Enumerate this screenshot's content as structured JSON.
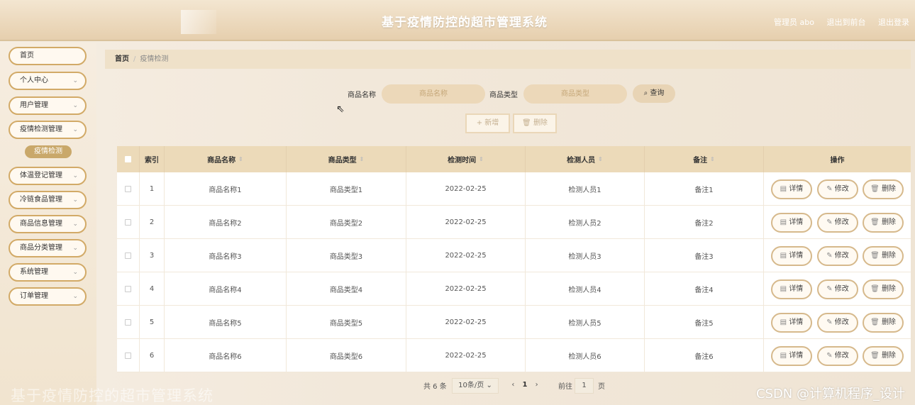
{
  "header": {
    "title": "基于疫情防控的超市管理系统",
    "user": "管理员 abo",
    "back_front": "退出到前台",
    "logout": "退出登录"
  },
  "sidebar": {
    "items": [
      {
        "label": "首页",
        "chevron": false
      },
      {
        "label": "个人中心",
        "chevron": true
      },
      {
        "label": "用户管理",
        "chevron": true
      },
      {
        "label": "疫情检测管理",
        "chevron": true
      },
      {
        "label": "体温登记管理",
        "chevron": true
      },
      {
        "label": "冷链食品管理",
        "chevron": true
      },
      {
        "label": "商品信息管理",
        "chevron": true
      },
      {
        "label": "商品分类管理",
        "chevron": true
      },
      {
        "label": "系统管理",
        "chevron": true
      },
      {
        "label": "订单管理",
        "chevron": true
      }
    ],
    "sub_active": "疫情检测",
    "chevron_glyph": "⌄"
  },
  "breadcrumb": {
    "home": "首页",
    "sep": "/",
    "current": "疫情检测"
  },
  "search": {
    "name_label": "商品名称",
    "name_placeholder": "商品名称",
    "type_label": "商品类型",
    "type_placeholder": "商品类型",
    "query_label": "查询",
    "query_icon": "search-icon"
  },
  "actions": {
    "add_label": "+ 新增",
    "delete_label": "删除"
  },
  "table": {
    "headers": [
      "索引",
      "商品名称",
      "商品类型",
      "检测时间",
      "检测人员",
      "备注",
      "操作"
    ],
    "sort_glyph": "⇕",
    "rows": [
      [
        "1",
        "商品名称1",
        "商品类型1",
        "2022-02-25",
        "检测人员1",
        "备注1"
      ],
      [
        "2",
        "商品名称2",
        "商品类型2",
        "2022-02-25",
        "检测人员2",
        "备注2"
      ],
      [
        "3",
        "商品名称3",
        "商品类型3",
        "2022-02-25",
        "检测人员3",
        "备注3"
      ],
      [
        "4",
        "商品名称4",
        "商品类型4",
        "2022-02-25",
        "检测人员4",
        "备注4"
      ],
      [
        "5",
        "商品名称5",
        "商品类型5",
        "2022-02-25",
        "检测人员5",
        "备注5"
      ],
      [
        "6",
        "商品名称6",
        "商品类型6",
        "2022-02-25",
        "检测人员6",
        "备注6"
      ]
    ],
    "ops": {
      "detail": "详情",
      "edit": "修改",
      "delete": "删除"
    }
  },
  "pagination": {
    "total": "共 6 条",
    "page_size": "10条/页 ⌄",
    "prev": "‹",
    "current": "1",
    "next": "›",
    "goto_label": "前往",
    "goto_value": "1",
    "page_unit": "页"
  },
  "watermark": {
    "left": "基于疫情防控的超市管理系统",
    "csdn": "CSDN @计算机程序_设计"
  },
  "colors": {
    "accent": "#d2aa67",
    "header_bg": "#ecd9bd",
    "active_sub": "#c9a86a"
  }
}
